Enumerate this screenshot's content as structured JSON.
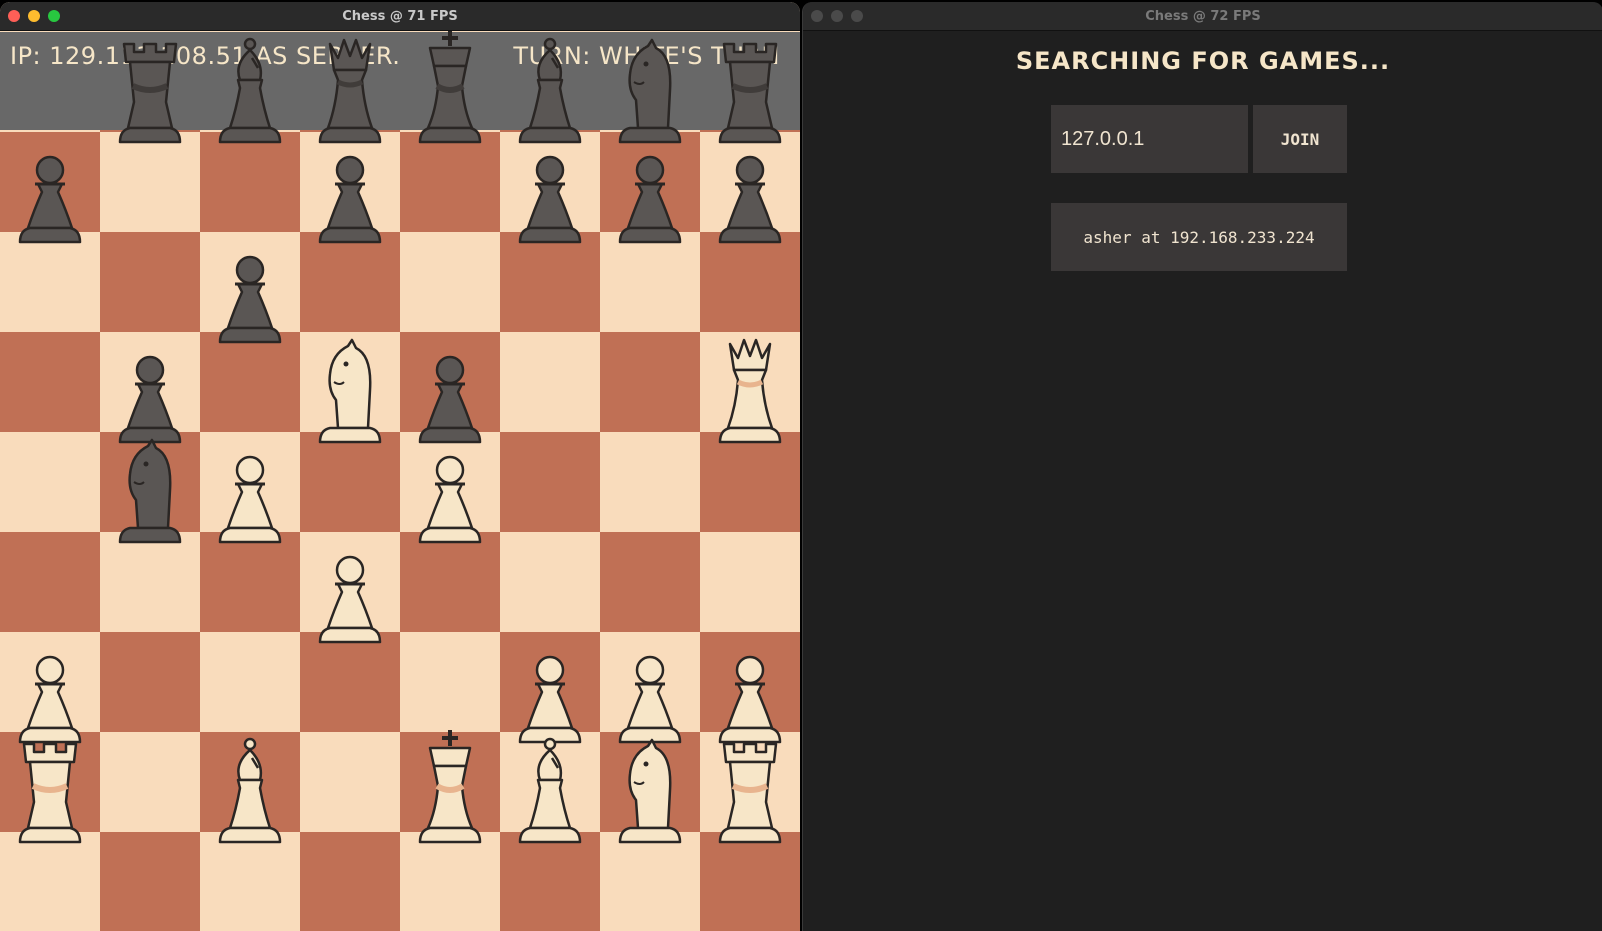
{
  "left_window": {
    "title": "Chess @ 71 FPS",
    "hud": {
      "ip_text": "IP: 129.113.108.51 AS SERVER.",
      "turn_text": "TURN: WHITE'S TURN"
    }
  },
  "right_window": {
    "title": "Chess @ 72 FPS",
    "heading": "SEARCHING FOR GAMES...",
    "ip_input_value": "127.0.0.1",
    "join_label": "JOIN",
    "found_games": [
      "asher at 192.168.233.224"
    ]
  },
  "board": {
    "colors": {
      "light": "#f9dcbc",
      "dark": "#c07055",
      "white_piece": "#f7e6c8",
      "black_piece": "#5a5654"
    },
    "pieces": [
      {
        "type": "rook",
        "color": "black",
        "col": 1,
        "row": 0
      },
      {
        "type": "bishop",
        "color": "black",
        "col": 2,
        "row": 0
      },
      {
        "type": "queen",
        "color": "black",
        "col": 3,
        "row": 0
      },
      {
        "type": "king",
        "color": "black",
        "col": 4,
        "row": 0
      },
      {
        "type": "bishop",
        "color": "black",
        "col": 5,
        "row": 0
      },
      {
        "type": "knight",
        "color": "black",
        "col": 6,
        "row": 0
      },
      {
        "type": "rook",
        "color": "black",
        "col": 7,
        "row": 0
      },
      {
        "type": "pawn",
        "color": "black",
        "col": 0,
        "row": 1
      },
      {
        "type": "pawn",
        "color": "black",
        "col": 3,
        "row": 1
      },
      {
        "type": "pawn",
        "color": "black",
        "col": 5,
        "row": 1
      },
      {
        "type": "pawn",
        "color": "black",
        "col": 6,
        "row": 1
      },
      {
        "type": "pawn",
        "color": "black",
        "col": 7,
        "row": 1
      },
      {
        "type": "pawn",
        "color": "black",
        "col": 2,
        "row": 2
      },
      {
        "type": "pawn",
        "color": "black",
        "col": 1,
        "row": 3
      },
      {
        "type": "knight",
        "color": "white",
        "col": 3,
        "row": 3
      },
      {
        "type": "pawn",
        "color": "black",
        "col": 4,
        "row": 3
      },
      {
        "type": "queen",
        "color": "white",
        "col": 7,
        "row": 3
      },
      {
        "type": "knight",
        "color": "black",
        "col": 1,
        "row": 4
      },
      {
        "type": "pawn",
        "color": "white",
        "col": 2,
        "row": 4
      },
      {
        "type": "pawn",
        "color": "white",
        "col": 4,
        "row": 4
      },
      {
        "type": "pawn",
        "color": "white",
        "col": 3,
        "row": 5
      },
      {
        "type": "pawn",
        "color": "white",
        "col": 0,
        "row": 6
      },
      {
        "type": "pawn",
        "color": "white",
        "col": 5,
        "row": 6
      },
      {
        "type": "pawn",
        "color": "white",
        "col": 6,
        "row": 6
      },
      {
        "type": "pawn",
        "color": "white",
        "col": 7,
        "row": 6
      },
      {
        "type": "rook",
        "color": "white",
        "col": 0,
        "row": 7
      },
      {
        "type": "bishop",
        "color": "white",
        "col": 2,
        "row": 7
      },
      {
        "type": "king",
        "color": "white",
        "col": 4,
        "row": 7
      },
      {
        "type": "bishop",
        "color": "white",
        "col": 5,
        "row": 7
      },
      {
        "type": "knight",
        "color": "white",
        "col": 6,
        "row": 7
      },
      {
        "type": "rook",
        "color": "white",
        "col": 7,
        "row": 7
      }
    ]
  }
}
